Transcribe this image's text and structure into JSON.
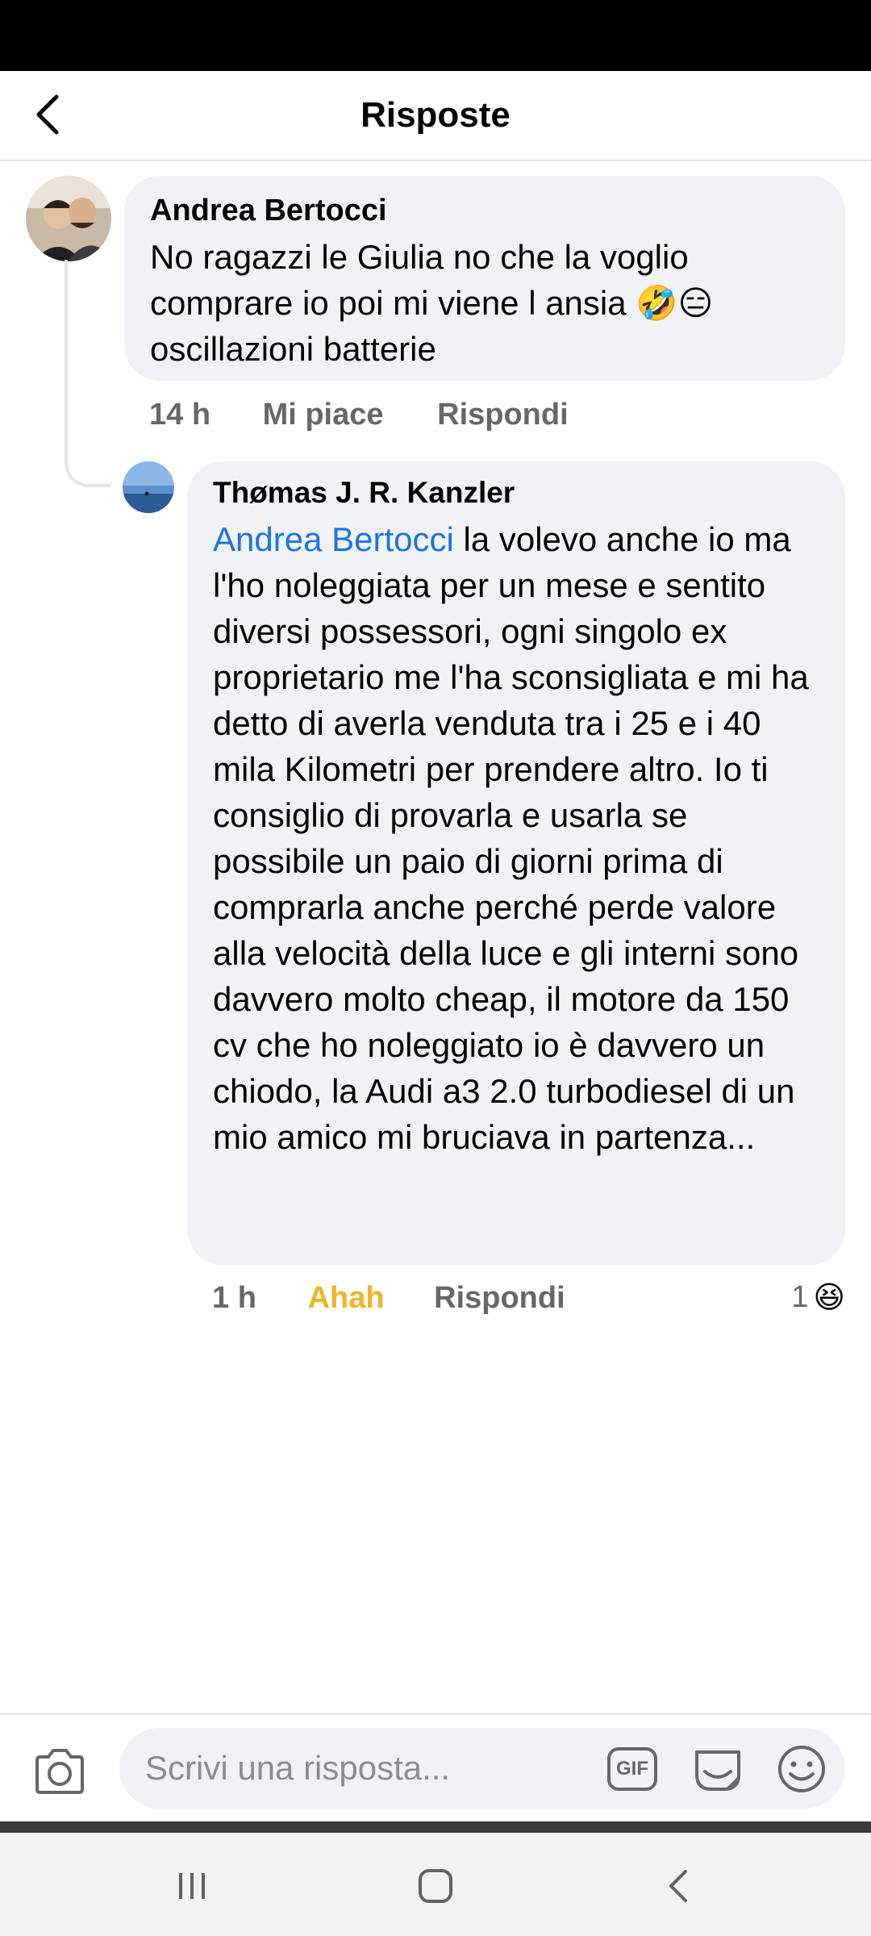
{
  "header": {
    "title": "Risposte",
    "back_icon": "chevron-left-icon"
  },
  "comments": [
    {
      "author": "Andrea Bertocci",
      "text": "No ragazzi le Giulia no che la voglio comprare io poi mi viene l ansia 🤣😑 oscillazioni batterie",
      "time": "14 h",
      "like_label": "Mi piace",
      "reply_label": "Rispondi"
    },
    {
      "author": "Thømas J. R. Kanzler",
      "mention": "Andrea Bertocci",
      "text": " la volevo anche io ma l'ho noleggiata per un mese e sentito diversi possessori, ogni singolo ex proprietario me l'ha sconsigliata e mi ha detto di averla venduta tra i 25 e i 40 mila Kilometri per prendere altro. Io ti consiglio di provarla e usarla se possibile un paio di giorni prima di comprarla anche perché perde valore alla velocità della luce e gli interni sono davvero molto cheap,  il motore da 150 cv che ho noleggiato io è davvero un chiodo, la Audi a3 2.0 turbodiesel di un mio amico mi bruciava in partenza...",
      "time": "1 h",
      "reaction_label": "Ahah",
      "reply_label": "Rispondi",
      "reaction_count": "1",
      "reaction_emoji": "😆"
    }
  ],
  "composer": {
    "placeholder": "Scrivi una risposta...",
    "gif_label": "GIF"
  },
  "colors": {
    "mention": "#1b74e4",
    "reaction": "#f0b428",
    "bubble": "#f0f2f5",
    "muted": "#65676b"
  }
}
